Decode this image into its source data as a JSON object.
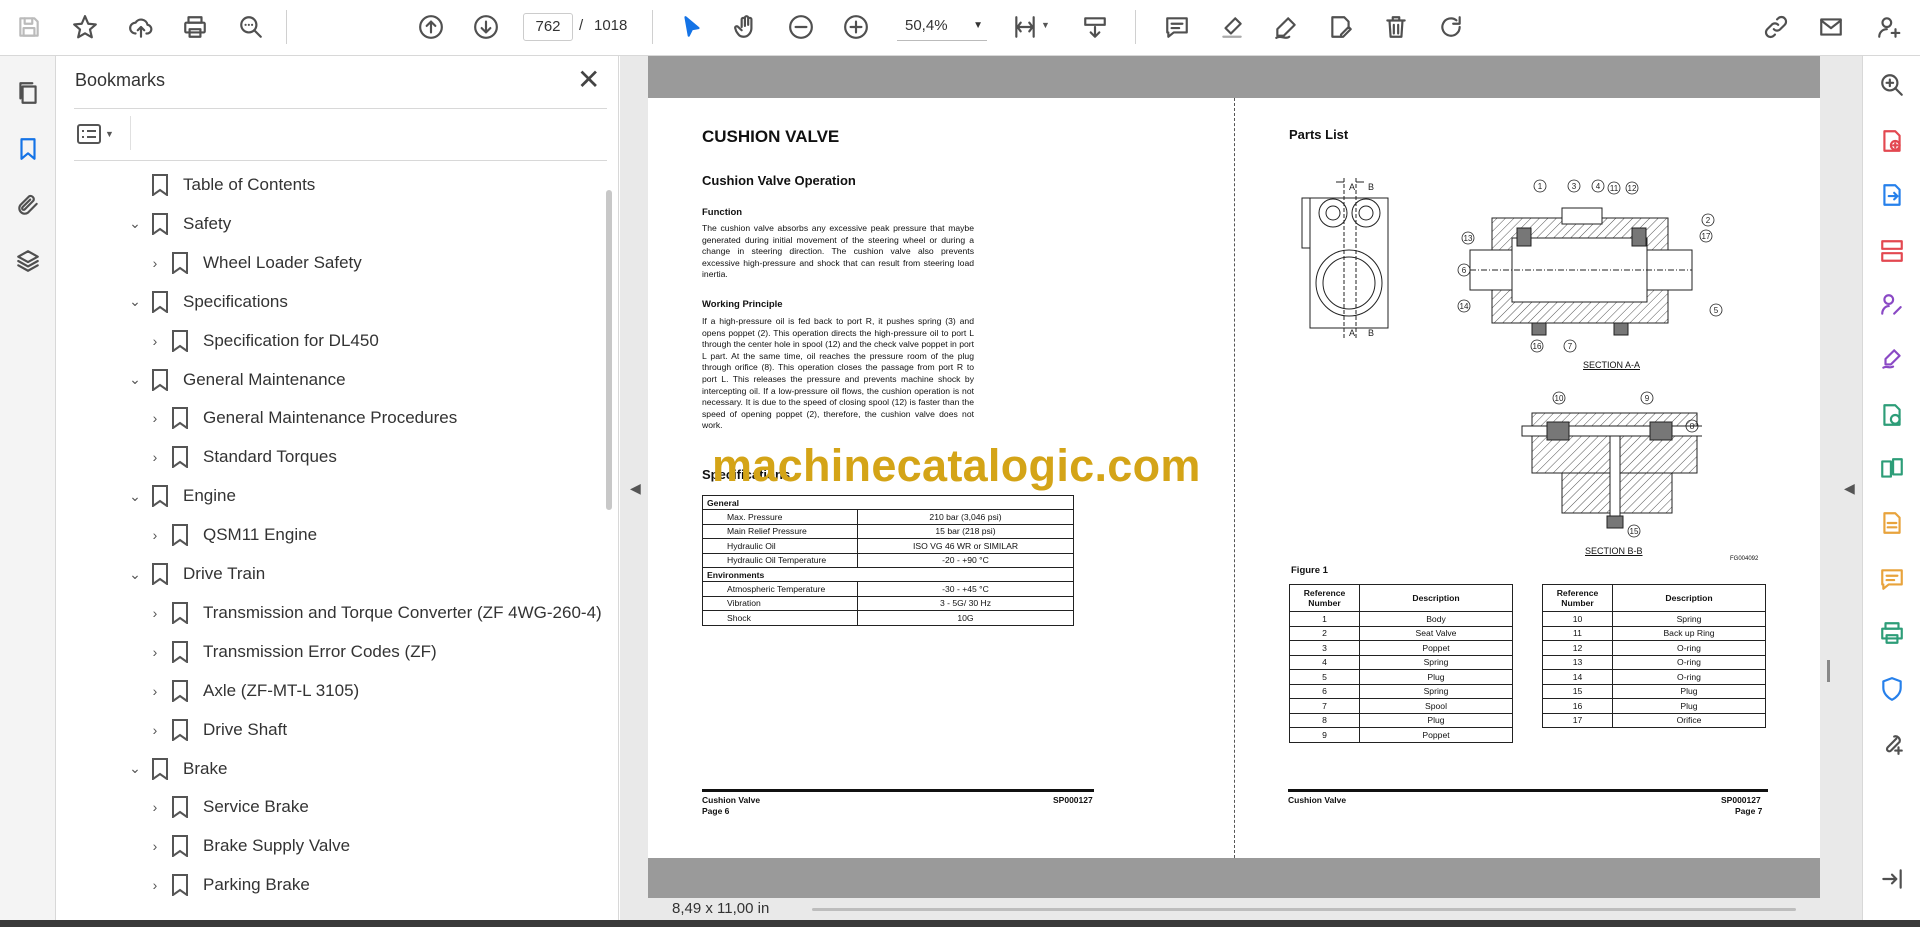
{
  "toolbar": {
    "page_current": "762",
    "page_separator": "/",
    "page_total": "1018",
    "zoom": "50,4%"
  },
  "bookmarks": {
    "title": "Bookmarks",
    "items": [
      {
        "label": "Table of Contents",
        "chevron": ""
      },
      {
        "label": "Safety",
        "chevron": "⌄"
      },
      {
        "label": "Wheel Loader Safety",
        "chevron": "›"
      },
      {
        "label": "Specifications",
        "chevron": "⌄"
      },
      {
        "label": "Specification for DL450",
        "chevron": "›"
      },
      {
        "label": "General Maintenance",
        "chevron": "⌄"
      },
      {
        "label": "General Maintenance Procedures",
        "chevron": "›"
      },
      {
        "label": "Standard Torques",
        "chevron": "›"
      },
      {
        "label": "Engine",
        "chevron": "⌄"
      },
      {
        "label": "QSM11 Engine",
        "chevron": "›"
      },
      {
        "label": "Drive Train",
        "chevron": "⌄"
      },
      {
        "label": "Transmission and Torque Converter (ZF 4WG-260-4)",
        "chevron": "›"
      },
      {
        "label": "Transmission Error Codes (ZF)",
        "chevron": "›"
      },
      {
        "label": "Axle (ZF-MT-L 3105)",
        "chevron": "›"
      },
      {
        "label": "Drive Shaft",
        "chevron": "›"
      },
      {
        "label": "Brake",
        "chevron": "⌄"
      },
      {
        "label": "Service Brake",
        "chevron": "›"
      },
      {
        "label": "Brake Supply Valve",
        "chevron": "›"
      },
      {
        "label": "Parking Brake",
        "chevron": "›"
      }
    ]
  },
  "status": {
    "page_size": "8,49 x 11,00 in"
  },
  "left_page": {
    "title": "CUSHION VALVE",
    "subtitle": "Cushion Valve Operation",
    "function_heading": "Function",
    "function_text": "The cushion valve absorbs any excessive peak pressure that maybe generated during initial movement of the steering wheel or during a change in steering direction. The cushion valve also prevents excessive high-pressure and shock that can result from steering load inertia.",
    "working_heading": "Working Principle",
    "working_text": "If a high-pressure oil is fed back to port R, it pushes spring (3) and opens poppet (2). This operation directs the high-pressure oil to port L through the center hole in spool (12) and the check valve poppet in port L part. At the same time, oil reaches the pressure room of the plug through orifice (8). This operation closes the passage from port R to port L. This releases the pressure and prevents machine shock by intercepting oil. If a low-pressure oil flows, the cushion operation is not necessary. It is due to the speed of closing spool (12) is faster than the speed of opening poppet (2), therefore, the cushion valve does not work.",
    "spec_heading": "Specifications",
    "spec_table": [
      {
        "label": "General",
        "value": "",
        "type": "group"
      },
      {
        "label": "Max. Pressure",
        "value": "210 bar (3,046 psi)",
        "type": "row"
      },
      {
        "label": "Main Relief Pressure",
        "value": "15 bar (218 psi)",
        "type": "row"
      },
      {
        "label": "Hydraulic Oil",
        "value": "ISO VG 46 WR or SIMILAR",
        "type": "row"
      },
      {
        "label": "Hydraulic Oil Temperature",
        "value": "-20 - +90 °C",
        "type": "row"
      },
      {
        "label": "Environments",
        "value": "",
        "type": "group"
      },
      {
        "label": "Atmospheric Temperature",
        "value": "-30 - +45 °C",
        "type": "row"
      },
      {
        "label": "Vibration",
        "value": "3 - 5G/ 30 Hz",
        "type": "row"
      },
      {
        "label": "Shock",
        "value": "10G",
        "type": "row"
      }
    ],
    "footer_left": "Cushion Valve",
    "footer_page": "Page 6",
    "footer_code": "SP000127"
  },
  "right_page": {
    "title": "Parts List",
    "figure_label": "Figure 1",
    "figure_code": "FG004092",
    "section_aa": "SECTION A-A",
    "section_bb": "SECTION B-B",
    "table_headers": {
      "ref": "Reference Number",
      "desc": "Description"
    },
    "parts_left": [
      {
        "ref": "1",
        "desc": "Body"
      },
      {
        "ref": "2",
        "desc": "Seat Valve"
      },
      {
        "ref": "3",
        "desc": "Poppet"
      },
      {
        "ref": "4",
        "desc": "Spring"
      },
      {
        "ref": "5",
        "desc": "Plug"
      },
      {
        "ref": "6",
        "desc": "Spring"
      },
      {
        "ref": "7",
        "desc": "Spool"
      },
      {
        "ref": "8",
        "desc": "Plug"
      },
      {
        "ref": "9",
        "desc": "Poppet"
      }
    ],
    "parts_right": [
      {
        "ref": "10",
        "desc": "Spring"
      },
      {
        "ref": "11",
        "desc": "Back up Ring"
      },
      {
        "ref": "12",
        "desc": "O-ring"
      },
      {
        "ref": "13",
        "desc": "O-ring"
      },
      {
        "ref": "14",
        "desc": "O-ring"
      },
      {
        "ref": "15",
        "desc": "Plug"
      },
      {
        "ref": "16",
        "desc": "Plug"
      },
      {
        "ref": "17",
        "desc": "Orifice"
      }
    ],
    "footer_left": "Cushion Valve",
    "footer_code": "SP000127",
    "footer_page": "Page 7"
  },
  "watermark": "machinecatalogic.com",
  "colors": {
    "accent_blue": "#1473e6",
    "watermark": "#d4a417",
    "rail_red": "#e34850",
    "rail_blue": "#2680eb",
    "rail_purple": "#8a49c5",
    "rail_green": "#2d9d78",
    "rail_yellow": "#e8a33c"
  }
}
